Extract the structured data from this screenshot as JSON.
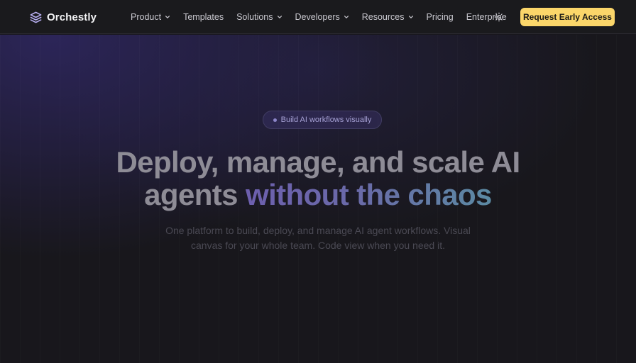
{
  "brand": {
    "name": "Orchestly",
    "icon": "layers-icon"
  },
  "nav": {
    "items": [
      {
        "label": "Product",
        "dropdown": true
      },
      {
        "label": "Templates",
        "dropdown": false
      },
      {
        "label": "Solutions",
        "dropdown": true
      },
      {
        "label": "Developers",
        "dropdown": true
      },
      {
        "label": "Resources",
        "dropdown": true
      },
      {
        "label": "Pricing",
        "dropdown": false
      },
      {
        "label": "Enterprise",
        "dropdown": false
      }
    ],
    "theme_toggle_icon": "sun-icon",
    "cta_label": "Request Early Access"
  },
  "hero": {
    "badge": "Build AI workflows visually",
    "headline_line1": "Deploy, manage, and scale AI",
    "headline_line2_plain": "agents",
    "headline_line2_highlight": "without the chaos",
    "subtitle_line1": "One platform to build, deploy, and manage AI agent workflows. Visual",
    "subtitle_line2": "canvas for your whole team. Code view when you need it."
  },
  "colors": {
    "accent": "#fbd66a",
    "background": "#18171c",
    "gradient_start": "#6d5fae",
    "gradient_end": "#5b8aa3"
  }
}
